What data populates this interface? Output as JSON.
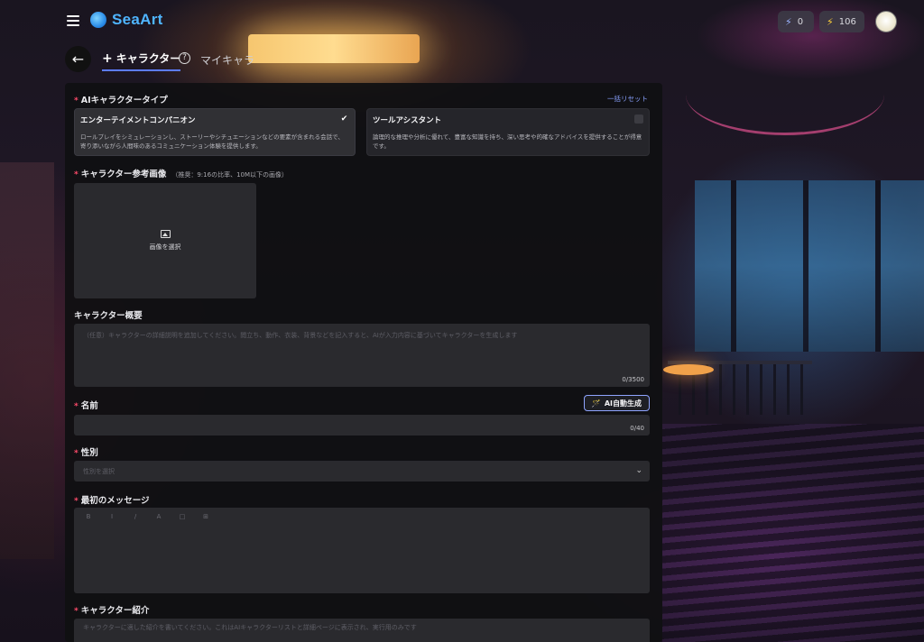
{
  "header": {
    "logo_text": "SeaArt",
    "stamina_count": "0",
    "energy_count": "106"
  },
  "subheader": {
    "create_tab_label": "キャラクター",
    "my_tab_label": "マイキャラ"
  },
  "form": {
    "reset_label": "一括リセット",
    "type_section": {
      "label": "AIキャラクタータイプ",
      "options": [
        {
          "title": "エンターテイメントコンパニオン",
          "description": "ロールプレイをシミュレーションし、ストーリーやシチュエーションなどの要素が含まれる会話で、寄り添いながら人間味のあるコミュニケーション体験を提供します。",
          "selected": true
        },
        {
          "title": "ツールアシスタント",
          "description": "論理的な推理や分析に優れて、豊富な知識を持ち、深い思考や的確なアドバイスを提供することが得意です。",
          "selected": false
        }
      ]
    },
    "reference_image": {
      "label": "キャラクター参考画像",
      "hint": "（推奨：9:16の比率、10M以下の画像）",
      "upload_label": "画像を選択"
    },
    "summary": {
      "label": "キャラクター概要",
      "placeholder": "（任意）キャラクターの詳細説明を追加してください。閲立ち、動作、衣装、背景などを記入すると、AIが入力内容に基づいてキャラクターを生成します",
      "counter": "0/3500"
    },
    "name": {
      "label": "名前",
      "ai_button_label": "AI自動生成",
      "counter": "0/40"
    },
    "gender": {
      "label": "性別",
      "placeholder": "性別を選択"
    },
    "first_message": {
      "label": "最初のメッセージ",
      "toolbar": [
        "B",
        "I",
        "/",
        "A",
        "□",
        "⊞"
      ]
    },
    "intro": {
      "label": "キャラクター紹介",
      "placeholder": "キャラクターに適した紹介を書いてください。これはAIキャラクターリストと詳細ページに表示され、実行用のみです"
    }
  }
}
